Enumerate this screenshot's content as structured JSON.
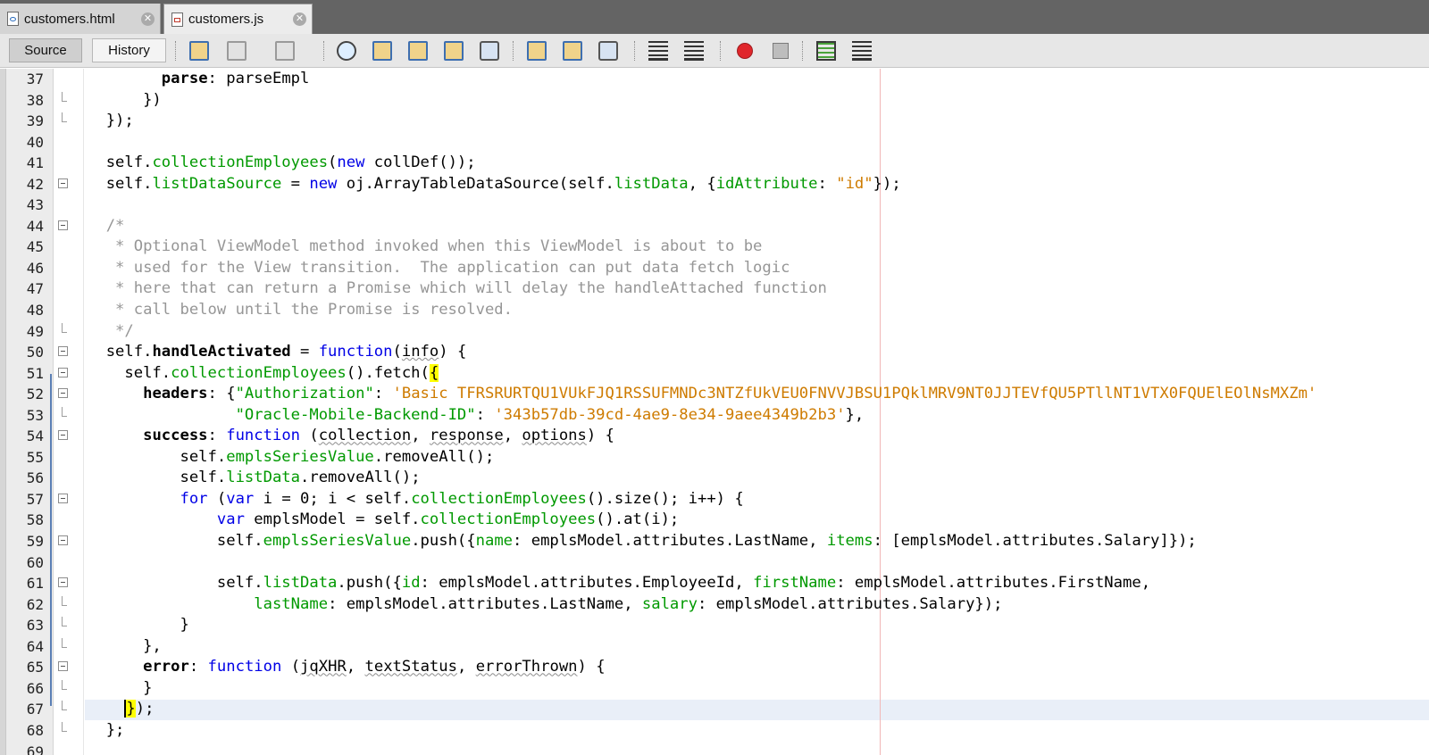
{
  "tabs": [
    {
      "label": "customers.html",
      "active": false,
      "icon": "html-file-icon"
    },
    {
      "label": "customers.js",
      "active": true,
      "icon": "js-file-icon"
    }
  ],
  "toolbar": {
    "source_label": "Source",
    "history_label": "History"
  },
  "editor": {
    "current_line": 67,
    "lines": [
      {
        "n": 37,
        "fold": "none",
        "tokens": [
          [
            "        "
          ],
          [
            "parse",
            "b"
          ],
          [
            ": parseEmpl"
          ]
        ]
      },
      {
        "n": 38,
        "fold": "end",
        "tokens": [
          [
            "      })"
          ]
        ]
      },
      {
        "n": 39,
        "fold": "end",
        "tokens": [
          [
            "  });"
          ]
        ]
      },
      {
        "n": 40,
        "fold": "none",
        "tokens": [
          [
            ""
          ]
        ]
      },
      {
        "n": 41,
        "fold": "none",
        "tokens": [
          [
            "  self."
          ],
          [
            "collectionEmployees",
            "prop"
          ],
          [
            "("
          ],
          [
            "new",
            "kw"
          ],
          [
            " collDef());"
          ]
        ]
      },
      {
        "n": 42,
        "fold": "start",
        "tokens": [
          [
            "  self."
          ],
          [
            "listDataSource",
            "prop"
          ],
          [
            " = "
          ],
          [
            "new",
            "kw"
          ],
          [
            " oj.ArrayTableDataSource(self."
          ],
          [
            "listData",
            "prop"
          ],
          [
            ", {"
          ],
          [
            "idAttribute",
            "prop"
          ],
          [
            ": "
          ],
          [
            "\"id\"",
            "str"
          ],
          [
            "});"
          ]
        ]
      },
      {
        "n": 43,
        "fold": "none",
        "tokens": [
          [
            ""
          ]
        ]
      },
      {
        "n": 44,
        "fold": "start",
        "tokens": [
          [
            "  /*",
            "cm"
          ]
        ]
      },
      {
        "n": 45,
        "fold": "none",
        "tokens": [
          [
            "   * Optional ViewModel method invoked when this ViewModel is about to be",
            "cm"
          ]
        ]
      },
      {
        "n": 46,
        "fold": "none",
        "tokens": [
          [
            "   * used for the View transition.  The application can put data fetch logic",
            "cm"
          ]
        ]
      },
      {
        "n": 47,
        "fold": "none",
        "tokens": [
          [
            "   * here that can return a Promise which will delay the handleAttached function",
            "cm"
          ]
        ]
      },
      {
        "n": 48,
        "fold": "none",
        "tokens": [
          [
            "   * call below until the Promise is resolved.",
            "cm"
          ]
        ]
      },
      {
        "n": 49,
        "fold": "end",
        "tokens": [
          [
            "   */",
            "cm"
          ]
        ]
      },
      {
        "n": 50,
        "fold": "start",
        "tokens": [
          [
            "  self."
          ],
          [
            "handleActivated",
            "b"
          ],
          [
            " = "
          ],
          [
            "function",
            "kw"
          ],
          [
            "("
          ],
          [
            "info",
            "wav"
          ],
          [
            ") {"
          ]
        ]
      },
      {
        "n": 51,
        "fold": "start",
        "tokens": [
          [
            "    self."
          ],
          [
            "collectionEmployees",
            "prop"
          ],
          [
            "().fetch("
          ],
          [
            "{",
            "brm"
          ]
        ]
      },
      {
        "n": 52,
        "fold": "start",
        "tokens": [
          [
            "      "
          ],
          [
            "headers",
            "b"
          ],
          [
            ": {"
          ],
          [
            "\"Authorization\"",
            "prop"
          ],
          [
            ": "
          ],
          [
            "'Basic TFRSRURTQU1VUkFJQ1RSSUFMNDc3NTZfUkVEU0FNVVJBSU1PQklMRV9NT0JJTEVfQU5PTllNT1VTX0FQUElEOlNsMXZm'",
            "str"
          ]
        ]
      },
      {
        "n": 53,
        "fold": "end",
        "tokens": [
          [
            "                "
          ],
          [
            "\"Oracle-Mobile-Backend-ID\"",
            "prop"
          ],
          [
            ": "
          ],
          [
            "'343b57db-39cd-4ae9-8e34-9aee4349b2b3'",
            "str"
          ],
          [
            "},"
          ]
        ]
      },
      {
        "n": 54,
        "fold": "start",
        "tokens": [
          [
            "      "
          ],
          [
            "success",
            "b"
          ],
          [
            ": "
          ],
          [
            "function",
            "kw"
          ],
          [
            " ("
          ],
          [
            "collection",
            "wav"
          ],
          [
            ", "
          ],
          [
            "response",
            "wav"
          ],
          [
            ", "
          ],
          [
            "options",
            "wav"
          ],
          [
            ") {"
          ]
        ]
      },
      {
        "n": 55,
        "fold": "none",
        "tokens": [
          [
            "          self."
          ],
          [
            "emplsSeriesValue",
            "prop"
          ],
          [
            ".removeAll();"
          ]
        ]
      },
      {
        "n": 56,
        "fold": "none",
        "tokens": [
          [
            "          self."
          ],
          [
            "listData",
            "prop"
          ],
          [
            ".removeAll();"
          ]
        ]
      },
      {
        "n": 57,
        "fold": "start",
        "tokens": [
          [
            "          "
          ],
          [
            "for",
            "kw"
          ],
          [
            " ("
          ],
          [
            "var",
            "kw"
          ],
          [
            " i = 0; i < self."
          ],
          [
            "collectionEmployees",
            "prop"
          ],
          [
            "().size(); i++) {"
          ]
        ]
      },
      {
        "n": 58,
        "fold": "none",
        "tokens": [
          [
            "              "
          ],
          [
            "var",
            "kw"
          ],
          [
            " emplsModel = self."
          ],
          [
            "collectionEmployees",
            "prop"
          ],
          [
            "().at(i);"
          ]
        ]
      },
      {
        "n": 59,
        "fold": "start",
        "tokens": [
          [
            "              self."
          ],
          [
            "emplsSeriesValue",
            "prop"
          ],
          [
            ".push({"
          ],
          [
            "name",
            "prop"
          ],
          [
            ": emplsModel.attributes.LastName, "
          ],
          [
            "items",
            "prop"
          ],
          [
            ": [emplsModel.attributes.Salary]});"
          ]
        ]
      },
      {
        "n": 60,
        "fold": "none",
        "tokens": [
          [
            ""
          ]
        ]
      },
      {
        "n": 61,
        "fold": "start",
        "tokens": [
          [
            "              self."
          ],
          [
            "listData",
            "prop"
          ],
          [
            ".push({"
          ],
          [
            "id",
            "prop"
          ],
          [
            ": emplsModel.attributes.EmployeeId, "
          ],
          [
            "firstName",
            "prop"
          ],
          [
            ": emplsModel.attributes.FirstName,"
          ]
        ]
      },
      {
        "n": 62,
        "fold": "end",
        "tokens": [
          [
            "                  "
          ],
          [
            "lastName",
            "prop"
          ],
          [
            ": emplsModel.attributes.LastName, "
          ],
          [
            "salary",
            "prop"
          ],
          [
            ": emplsModel.attributes.Salary});"
          ]
        ]
      },
      {
        "n": 63,
        "fold": "end",
        "tokens": [
          [
            "          }"
          ]
        ]
      },
      {
        "n": 64,
        "fold": "end",
        "tokens": [
          [
            "      },"
          ]
        ]
      },
      {
        "n": 65,
        "fold": "start",
        "tokens": [
          [
            "      "
          ],
          [
            "error",
            "b"
          ],
          [
            ": "
          ],
          [
            "function",
            "kw"
          ],
          [
            " ("
          ],
          [
            "jqXHR",
            "wav"
          ],
          [
            ", "
          ],
          [
            "textStatus",
            "wav"
          ],
          [
            ", "
          ],
          [
            "errorThrown",
            "wav"
          ],
          [
            ") {"
          ]
        ]
      },
      {
        "n": 66,
        "fold": "end",
        "tokens": [
          [
            "      }"
          ]
        ]
      },
      {
        "n": 67,
        "fold": "end",
        "tokens": [
          [
            "    "
          ],
          [
            "}",
            "brm caret"
          ],
          [
            ");"
          ]
        ]
      },
      {
        "n": 68,
        "fold": "end",
        "tokens": [
          [
            "  };"
          ]
        ]
      },
      {
        "n": 69,
        "fold": "none",
        "tokens": [
          [
            ""
          ]
        ]
      }
    ]
  }
}
